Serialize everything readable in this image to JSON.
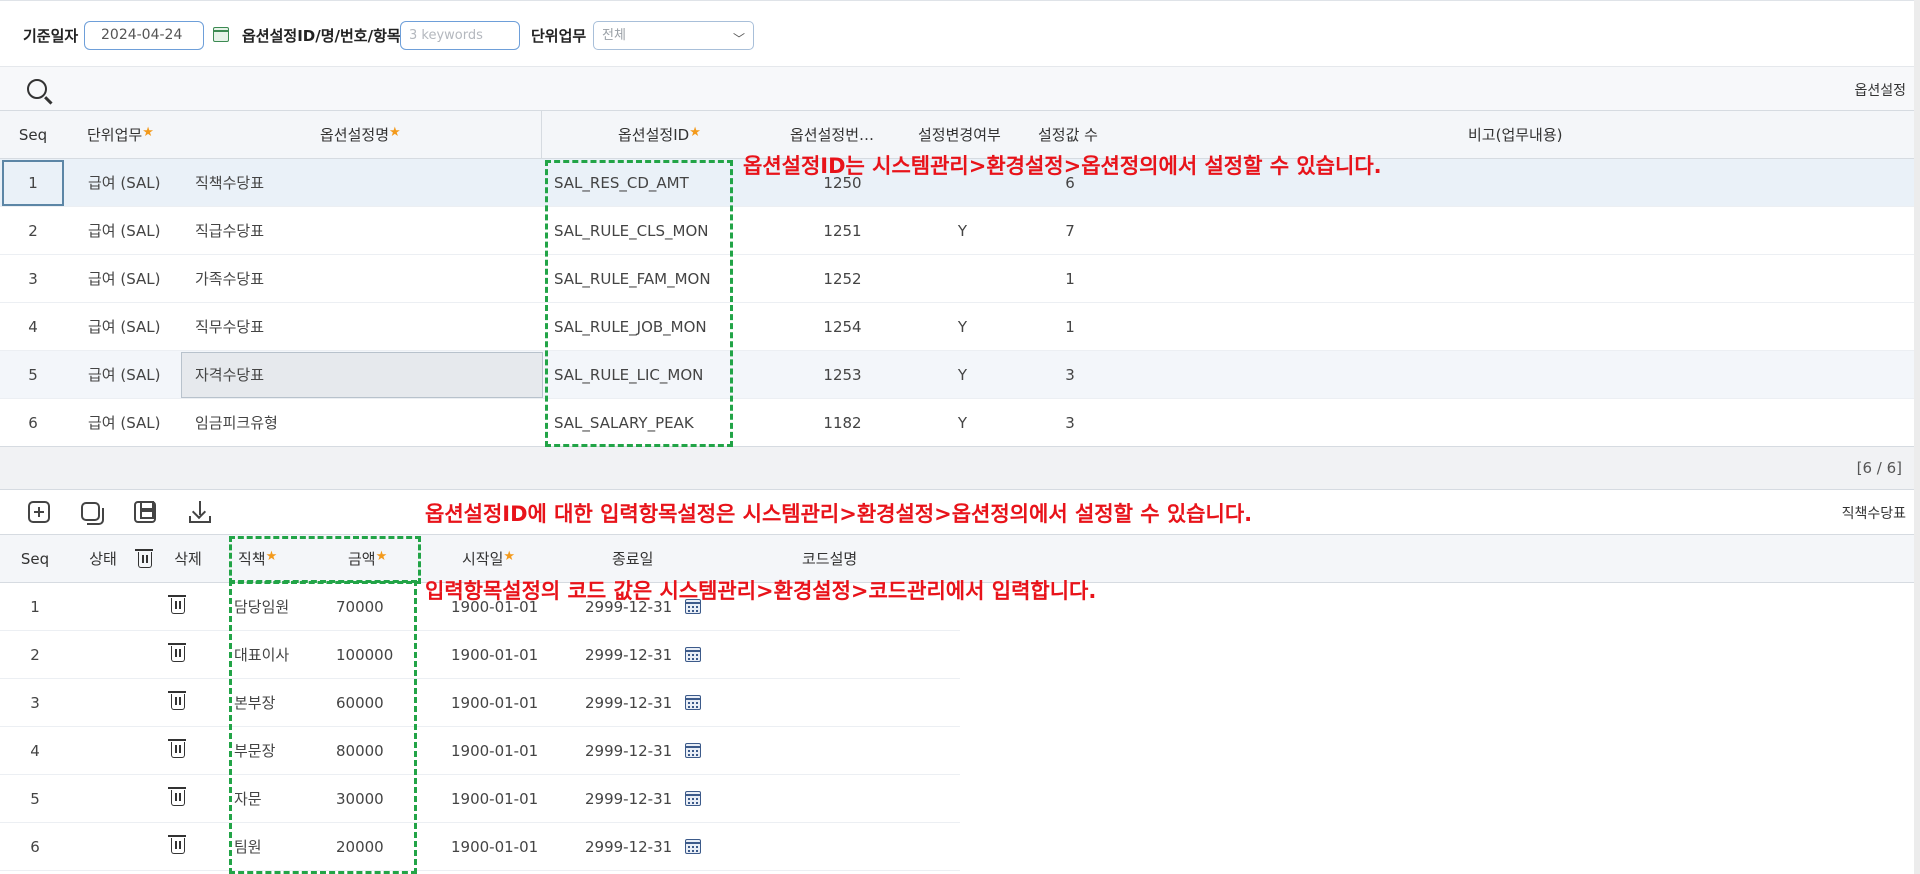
{
  "filter": {
    "date_label": "기준일자",
    "date_value": "2024-04-24",
    "search_label": "옵션설정ID/명/번호/항목",
    "search_placeholder": "3 keywords",
    "unit_label": "단위업무",
    "unit_value": "전체"
  },
  "top_grid": {
    "title": "옵션설정",
    "columns": [
      "Seq",
      "단위업무",
      "옵션설정명",
      "옵션설정ID",
      "옵션설정번…",
      "설정변경여부",
      "설정값 수",
      "비고(업무내용)"
    ],
    "rows": [
      {
        "seq": "1",
        "unit": "급여 (SAL)",
        "name": "직책수당표",
        "id": "SAL_RES_CD_AMT",
        "no": "1250",
        "changed": "",
        "count": "6"
      },
      {
        "seq": "2",
        "unit": "급여 (SAL)",
        "name": "직급수당표",
        "id": "SAL_RULE_CLS_MON",
        "no": "1251",
        "changed": "Y",
        "count": "7"
      },
      {
        "seq": "3",
        "unit": "급여 (SAL)",
        "name": "가족수당표",
        "id": "SAL_RULE_FAM_MON",
        "no": "1252",
        "changed": "",
        "count": "1"
      },
      {
        "seq": "4",
        "unit": "급여 (SAL)",
        "name": "직무수당표",
        "id": "SAL_RULE_JOB_MON",
        "no": "1254",
        "changed": "Y",
        "count": "1"
      },
      {
        "seq": "5",
        "unit": "급여 (SAL)",
        "name": "자격수당표",
        "id": "SAL_RULE_LIC_MON",
        "no": "1253",
        "changed": "Y",
        "count": "3"
      },
      {
        "seq": "6",
        "unit": "급여 (SAL)",
        "name": "임금피크유형",
        "id": "SAL_SALARY_PEAK",
        "no": "1182",
        "changed": "Y",
        "count": "3"
      }
    ],
    "count_text": "[6 / 6]"
  },
  "bottom_grid": {
    "title": "직책수당표",
    "columns": [
      "Seq",
      "상태",
      "삭제",
      "직책",
      "금액",
      "시작일",
      "종료일",
      "코드설명"
    ],
    "rows": [
      {
        "seq": "1",
        "position": "담당임원",
        "amount": "70000",
        "start": "1900-01-01",
        "end": "2999-12-31"
      },
      {
        "seq": "2",
        "position": "대표이사",
        "amount": "100000",
        "start": "1900-01-01",
        "end": "2999-12-31"
      },
      {
        "seq": "3",
        "position": "본부장",
        "amount": "60000",
        "start": "1900-01-01",
        "end": "2999-12-31"
      },
      {
        "seq": "4",
        "position": "부문장",
        "amount": "80000",
        "start": "1900-01-01",
        "end": "2999-12-31"
      },
      {
        "seq": "5",
        "position": "자문",
        "amount": "30000",
        "start": "1900-01-01",
        "end": "2999-12-31"
      },
      {
        "seq": "6",
        "position": "팀원",
        "amount": "20000",
        "start": "1900-01-01",
        "end": "2999-12-31"
      }
    ]
  },
  "annotations": {
    "a1": "옵션설정ID는 시스템관리>환경설정>옵션정의에서 설정할 수 있습니다.",
    "a2": "옵션설정ID에 대한 입력항목설정은 시스템관리>환경설정>옵션정의에서 설정할 수 있습니다.",
    "a3": "입력항목설정의 코드 값은 시스템관리>환경설정>코드관리에서 입력합니다."
  }
}
